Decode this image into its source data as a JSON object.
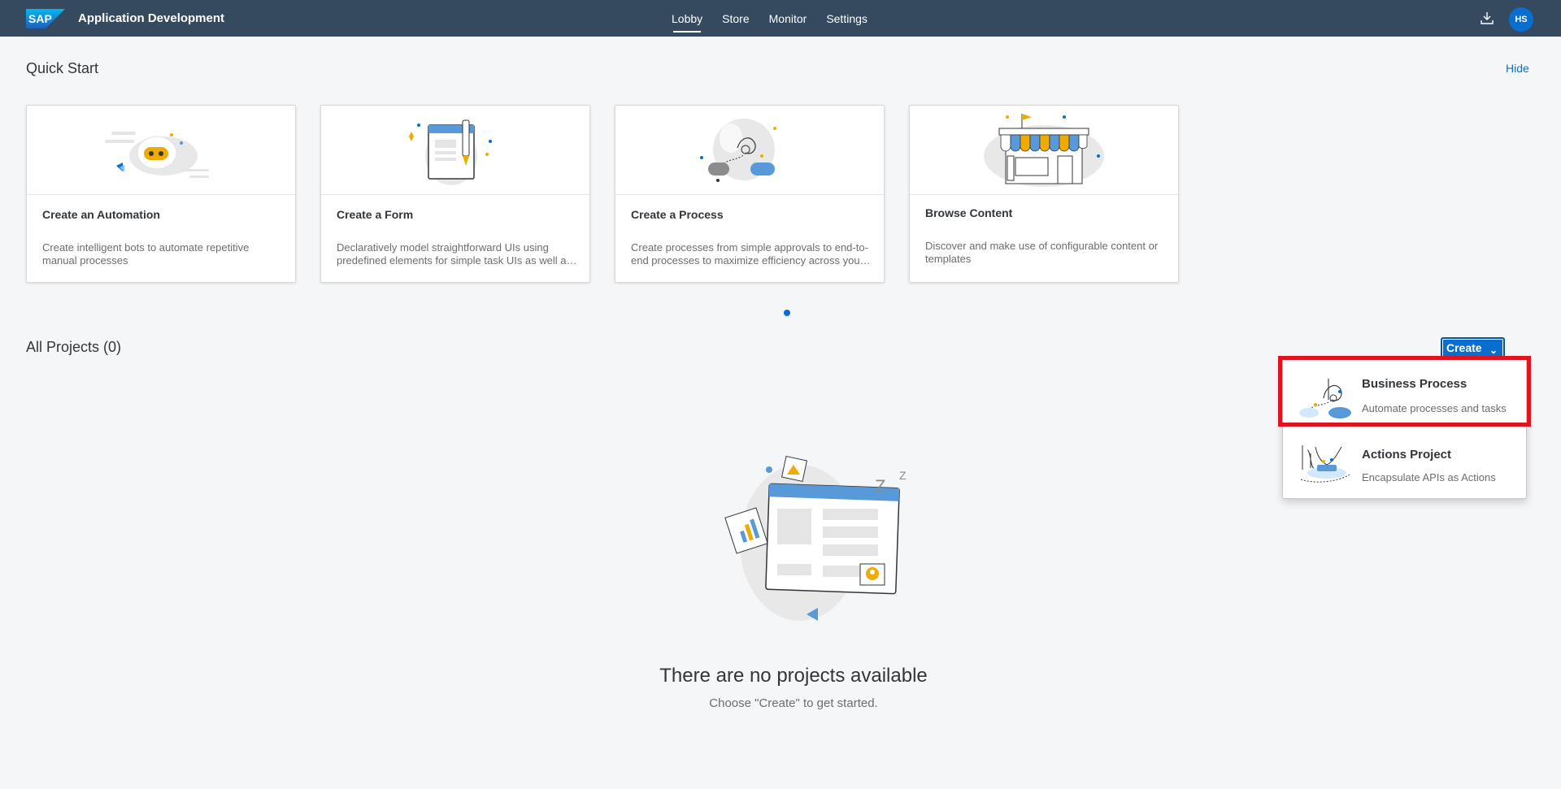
{
  "shell": {
    "logo_text": "SAP",
    "app_title": "Application Development",
    "nav": [
      {
        "label": "Lobby",
        "active": true
      },
      {
        "label": "Store",
        "active": false
      },
      {
        "label": "Monitor",
        "active": false
      },
      {
        "label": "Settings",
        "active": false
      }
    ],
    "download_icon": "download-icon",
    "avatar_initials": "HS"
  },
  "quick_start": {
    "title": "Quick Start",
    "hide_label": "Hide",
    "cards": [
      {
        "icon": "robot-illustration",
        "title": "Create an Automation",
        "description": "Create intelligent bots to automate repetitive manual processes"
      },
      {
        "icon": "form-illustration",
        "title": "Create a Form",
        "description": "Declaratively model straightforward UIs using predefined elements for simple task UIs as well as complex forms"
      },
      {
        "icon": "process-illustration",
        "title": "Create a Process",
        "description": "Create processes from simple approvals to end-to-end processes to maximize efficiency across your organization"
      },
      {
        "icon": "store-illustration",
        "title": "Browse Content",
        "description": "Discover and make use of configurable content or templates"
      }
    ]
  },
  "projects": {
    "title": "All Projects (0)",
    "create_label": "Create",
    "menu": [
      {
        "icon": "process-illustration",
        "title": "Business Process",
        "description": "Automate processes and tasks",
        "highlighted": true
      },
      {
        "icon": "actions-illustration",
        "title": "Actions Project",
        "description": "Encapsulate APIs as Actions",
        "highlighted": false
      }
    ],
    "empty_title": "There are no projects available",
    "empty_subtitle": "Choose \"Create\" to get started."
  },
  "colors": {
    "shell": "#354a5f",
    "accent": "#0a6ed1",
    "highlight": "#e0141e",
    "background": "#f5f6f7"
  }
}
